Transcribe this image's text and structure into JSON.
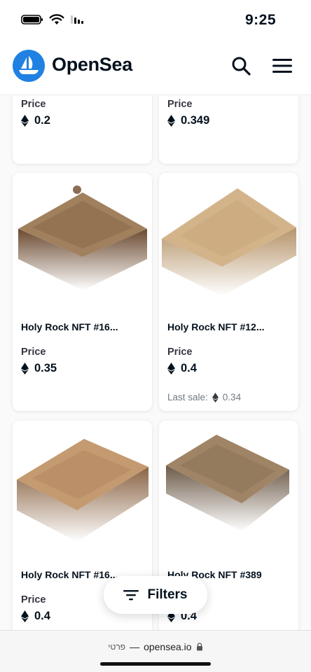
{
  "status_bar": {
    "time": "9:25"
  },
  "header": {
    "brand": "OpenSea"
  },
  "cards": [
    {
      "title": "",
      "price_label": "Price",
      "price": "0.2",
      "last_sale_label": "",
      "last_sale": ""
    },
    {
      "title": "",
      "price_label": "Price",
      "price": "0.349",
      "last_sale_label": "",
      "last_sale": ""
    },
    {
      "title": "Holy Rock NFT #16...",
      "price_label": "Price",
      "price": "0.35",
      "last_sale_label": "",
      "last_sale": ""
    },
    {
      "title": "Holy Rock NFT #12...",
      "price_label": "Price",
      "price": "0.4",
      "last_sale_label": "Last sale:",
      "last_sale": "0.34"
    },
    {
      "title": "Holy Rock NFT #16...",
      "price_label": "Price",
      "price": "0.4",
      "last_sale_label": "",
      "last_sale": ""
    },
    {
      "title": "Holy Rock NFT #389",
      "price_label": "",
      "price": "0.4",
      "last_sale_label": "",
      "last_sale": ""
    }
  ],
  "filters": {
    "label": "Filters"
  },
  "browser": {
    "privacy": "פרטי",
    "separator": "—",
    "url": "opensea.io"
  },
  "colors": {
    "brand": "#2081e2",
    "text": "#04111d",
    "muted": "#707a83"
  }
}
